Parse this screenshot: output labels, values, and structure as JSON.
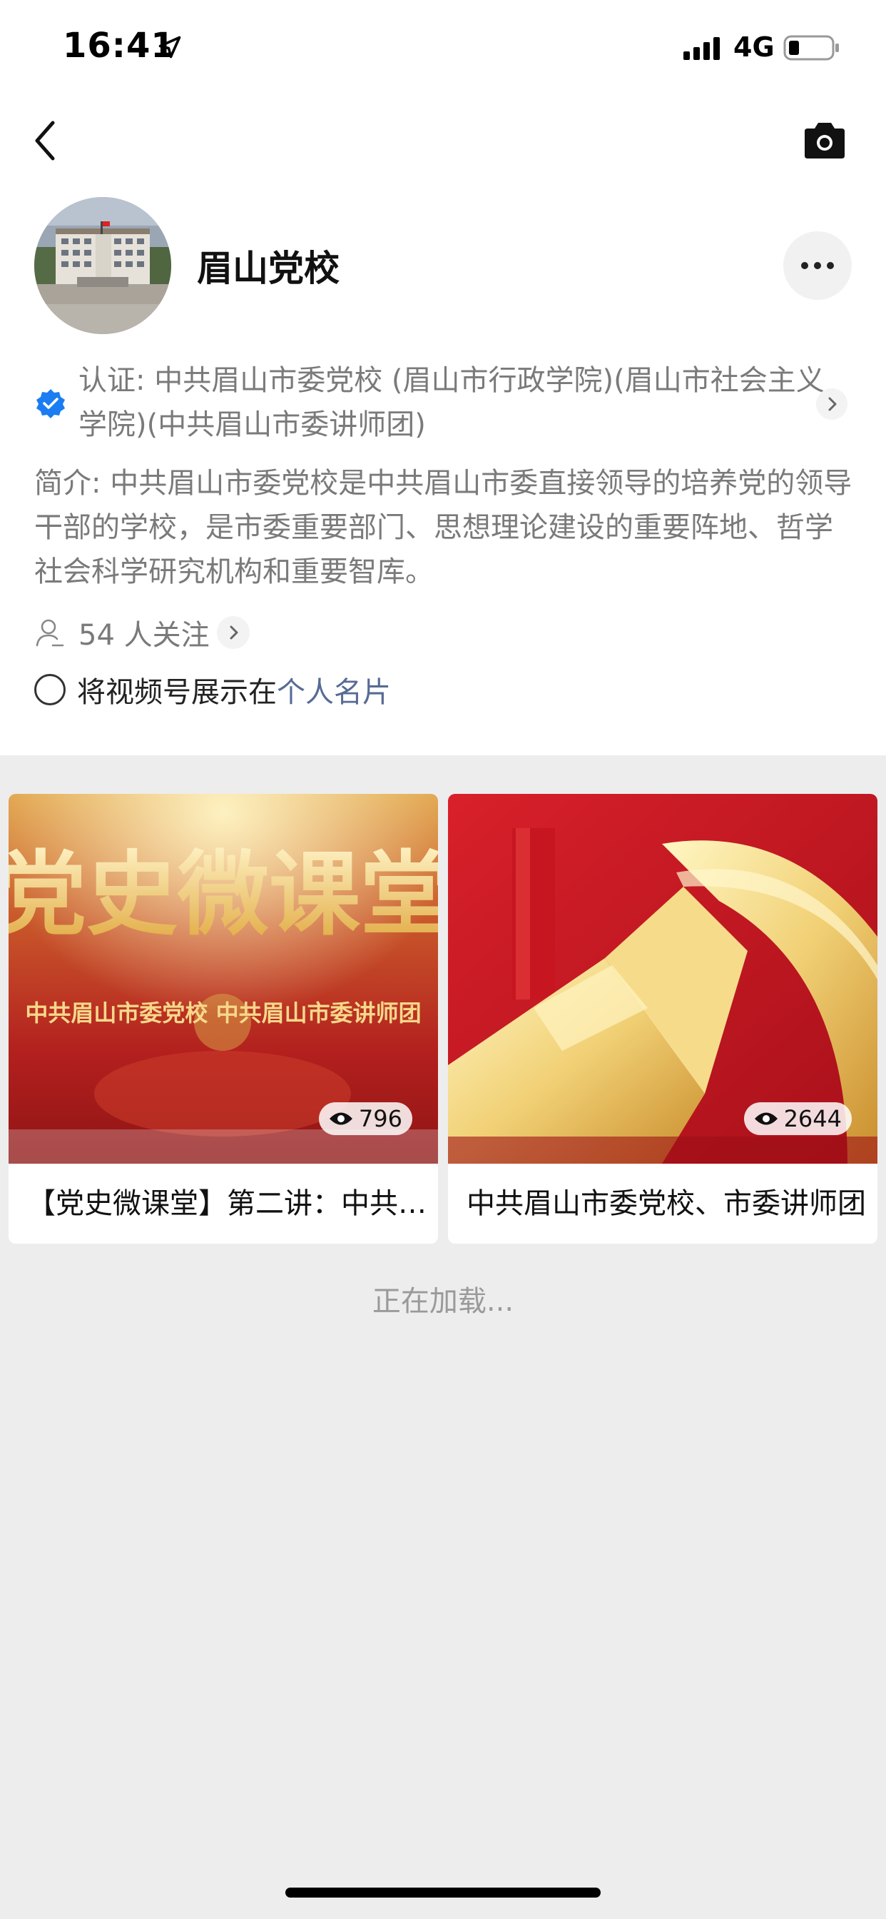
{
  "status_bar": {
    "time": "16:41",
    "network": "4G",
    "icons": [
      "location-arrow-icon",
      "signal-icon",
      "battery-icon"
    ]
  },
  "nav": {
    "back_icon": "chevron-left-icon",
    "camera_icon": "camera-icon"
  },
  "profile": {
    "name": "眉山党校",
    "more_icon": "more-dots-icon",
    "verification": "认证: 中共眉山市委党校 (眉山市行政学院)(眉山市社会主义学院)(中共眉山市委讲师团)",
    "intro": "简介: 中共眉山市委党校是中共眉山市委直接领导的培养党的领导干部的学校，是市委重要部门、思想理论建设的重要阵地、哲学社会科学研究机构和重要智库。",
    "followers": "54 人关注",
    "show_on_card_prefix": "将视频号展示在",
    "show_on_card_link": "个人名片"
  },
  "videos": [
    {
      "title": "【党史微课堂】第二讲：中共眉山市委党校",
      "views": "796",
      "thumb_title": "党史微课堂",
      "thumb_subtitle": "中共眉山市委党校  中共眉山市委讲师团"
    },
    {
      "title": "中共眉山市委党校、市委讲师团",
      "views": "2644"
    }
  ],
  "loading": "正在加载...",
  "colors": {
    "link": "#576b95",
    "verify_blue": "#1a7df2",
    "gray_text": "#7a7a7a"
  }
}
